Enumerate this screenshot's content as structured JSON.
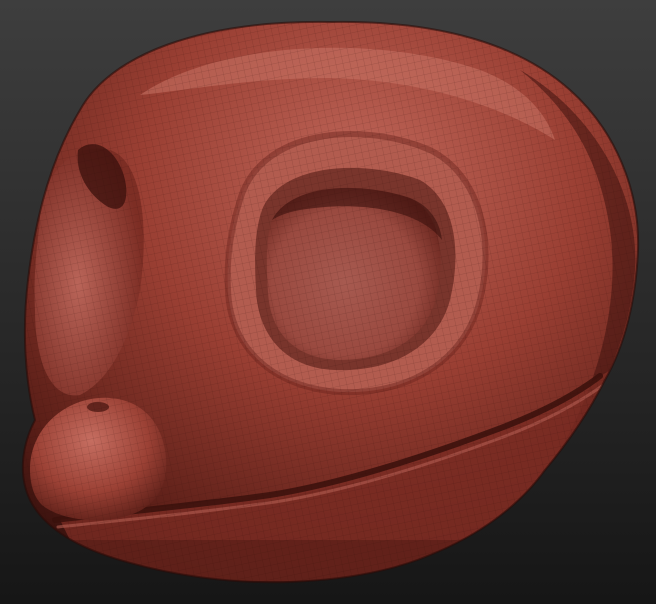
{
  "scene": {
    "subject": "sculpted-head-mesh",
    "colors": {
      "background_top": "#3e3e3e",
      "background_bottom": "#161616",
      "clay_light": "#c0675a",
      "clay_mid": "#9a3f33",
      "clay_dark": "#5a1e17",
      "clay_shadow": "#3a120e",
      "wireframe": "#2a0b08"
    }
  }
}
